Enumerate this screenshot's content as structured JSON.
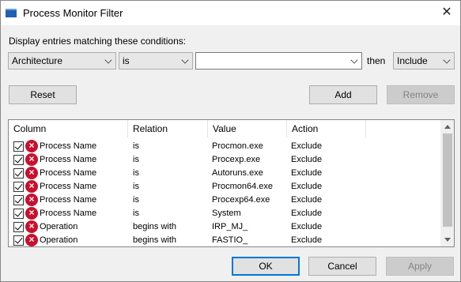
{
  "window": {
    "title": "Process Monitor Filter",
    "close_glyph": "✕"
  },
  "conditions": {
    "label": "Display entries matching these conditions:",
    "column": "Architecture",
    "relation": "is",
    "value": "",
    "then_label": "then",
    "action": "Include"
  },
  "buttons": {
    "reset": "Reset",
    "add": "Add",
    "remove": "Remove",
    "ok": "OK",
    "cancel": "Cancel",
    "apply": "Apply"
  },
  "list": {
    "headers": [
      "Column",
      "Relation",
      "Value",
      "Action"
    ],
    "rows": [
      {
        "checked": true,
        "column": "Process Name",
        "relation": "is",
        "value": "Procmon.exe",
        "action": "Exclude"
      },
      {
        "checked": true,
        "column": "Process Name",
        "relation": "is",
        "value": "Procexp.exe",
        "action": "Exclude"
      },
      {
        "checked": true,
        "column": "Process Name",
        "relation": "is",
        "value": "Autoruns.exe",
        "action": "Exclude"
      },
      {
        "checked": true,
        "column": "Process Name",
        "relation": "is",
        "value": "Procmon64.exe",
        "action": "Exclude"
      },
      {
        "checked": true,
        "column": "Process Name",
        "relation": "is",
        "value": "Procexp64.exe",
        "action": "Exclude"
      },
      {
        "checked": true,
        "column": "Process Name",
        "relation": "is",
        "value": "System",
        "action": "Exclude"
      },
      {
        "checked": true,
        "column": "Operation",
        "relation": "begins with",
        "value": "IRP_MJ_",
        "action": "Exclude"
      },
      {
        "checked": true,
        "column": "Operation",
        "relation": "begins with",
        "value": "FASTIO_",
        "action": "Exclude"
      }
    ]
  },
  "icons": {
    "app": "process-monitor-icon",
    "rule": "exclude-x-icon",
    "check": "checkbox"
  },
  "colors": {
    "exclude_icon": "#c8102e",
    "default_button_border": "#0078d7"
  }
}
